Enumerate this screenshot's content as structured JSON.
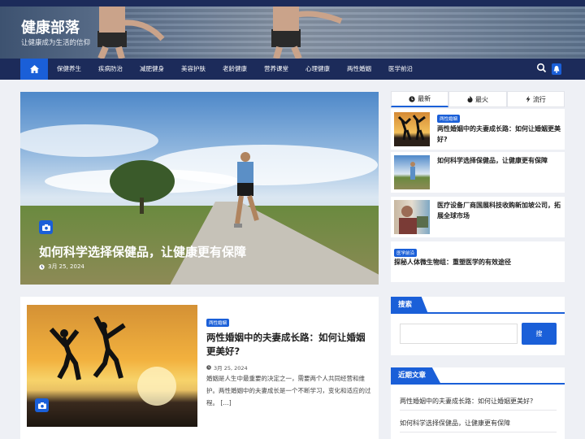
{
  "site": {
    "title": "健康部落",
    "subtitle": "让健康成为生活的信仰"
  },
  "nav": {
    "home_icon": "home-icon",
    "items": [
      "保健养生",
      "疾病防治",
      "减肥健身",
      "美容护肤",
      "老龄健康",
      "营养课堂",
      "心理健康",
      "两性婚姻",
      "医学前沿"
    ],
    "search_icon": "search-icon",
    "bell_icon": "bell-icon"
  },
  "hero": {
    "title": "如何科学选择保健品，让健康更有保障",
    "date": "3月 25, 2024",
    "camera_icon": "camera-icon"
  },
  "tabs": [
    {
      "label": "最新",
      "icon": "clock-icon"
    },
    {
      "label": "最火",
      "icon": "fire-icon"
    },
    {
      "label": "流行",
      "icon": "bolt-icon"
    }
  ],
  "tab_posts": [
    {
      "badge": "两性婚姻",
      "title": "两性婚姻中的夫妻成长路：如何让婚姻更美好?"
    },
    {
      "badge": "",
      "title": "如何科学选择保健品，让健康更有保障"
    },
    {
      "badge": "",
      "title": "医疗设备厂商国展科技收购新加坡公司，拓展全球市场"
    },
    {
      "badge": "医学前沿",
      "title": "探秘人体微生物组：重塑医学的有效途径"
    }
  ],
  "article": {
    "badge": "两性婚姻",
    "title": "两性婚姻中的夫妻成长路：如何让婚姻更美好?",
    "date": "3月 25, 2024",
    "excerpt": "婚姻是人生中最重要的决定之一，需要两个人共同经营和维护。两性婚姻中的夫妻成长是一个不断学习，变化和适应的过程。 […]"
  },
  "search_widget": {
    "title": "搜索",
    "placeholder": "",
    "button": "搜"
  },
  "recent_widget": {
    "title": "近期文章",
    "items": [
      "两性婚姻中的夫妻成长路：如何让婚姻更美好?",
      "如何科学选择保健品，让健康更有保障"
    ]
  },
  "colors": {
    "accent": "#1a5fd8",
    "nav_bg": "#1c2b5a",
    "page_bg": "#eef0f5"
  }
}
